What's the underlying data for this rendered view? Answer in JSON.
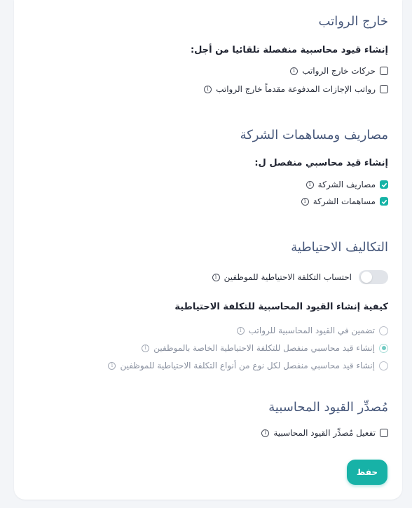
{
  "off_payroll": {
    "title": "خارج الرواتب",
    "subheading": "إنشاء قيود محاسبية منفصلة تلقائيا من أجل:",
    "options": [
      {
        "label": "حركات خارج الرواتب",
        "checked": false
      },
      {
        "label": "رواتب الإجازات المدفوعة مقدماً خارج الرواتب",
        "checked": false
      }
    ]
  },
  "company_costs": {
    "title": "مصاريف ومساهمات الشركة",
    "subheading": "إنشاء قيد محاسبي منفصل ل:",
    "options": [
      {
        "label": "مصاريف الشركة",
        "checked": true
      },
      {
        "label": "مساهمات الشركة",
        "checked": true
      }
    ]
  },
  "provisions": {
    "title": "التكاليف الاحتياطية",
    "toggle_label": "احتساب التكلفة الاحتياطية للموظفين",
    "toggle_on": false,
    "subheading": "كيفية إنشاء القيود المحاسبية للتكلفة الاحتياطية",
    "options": [
      {
        "label": "تضمين في القيود المحاسبية للرواتب",
        "selected": false
      },
      {
        "label": "إنشاء قيد محاسبي منفصل للتكلفة الاحتياطية الخاصة بالموظفين",
        "selected": true
      },
      {
        "label": "إنشاء قيد محاسبي منفصل لكل نوع من أنواع التكلفة الاحتياطية للموظفين",
        "selected": false
      }
    ]
  },
  "exporter": {
    "title": "مُصدِّر القيود المحاسبية",
    "options": [
      {
        "label": "تفعيل مُصدِّر القيود المحاسبية",
        "checked": false
      }
    ]
  },
  "info_glyph": "i",
  "save_label": "حفظ",
  "colors": {
    "accent": "#17b2a7",
    "section_title": "#46577a"
  }
}
